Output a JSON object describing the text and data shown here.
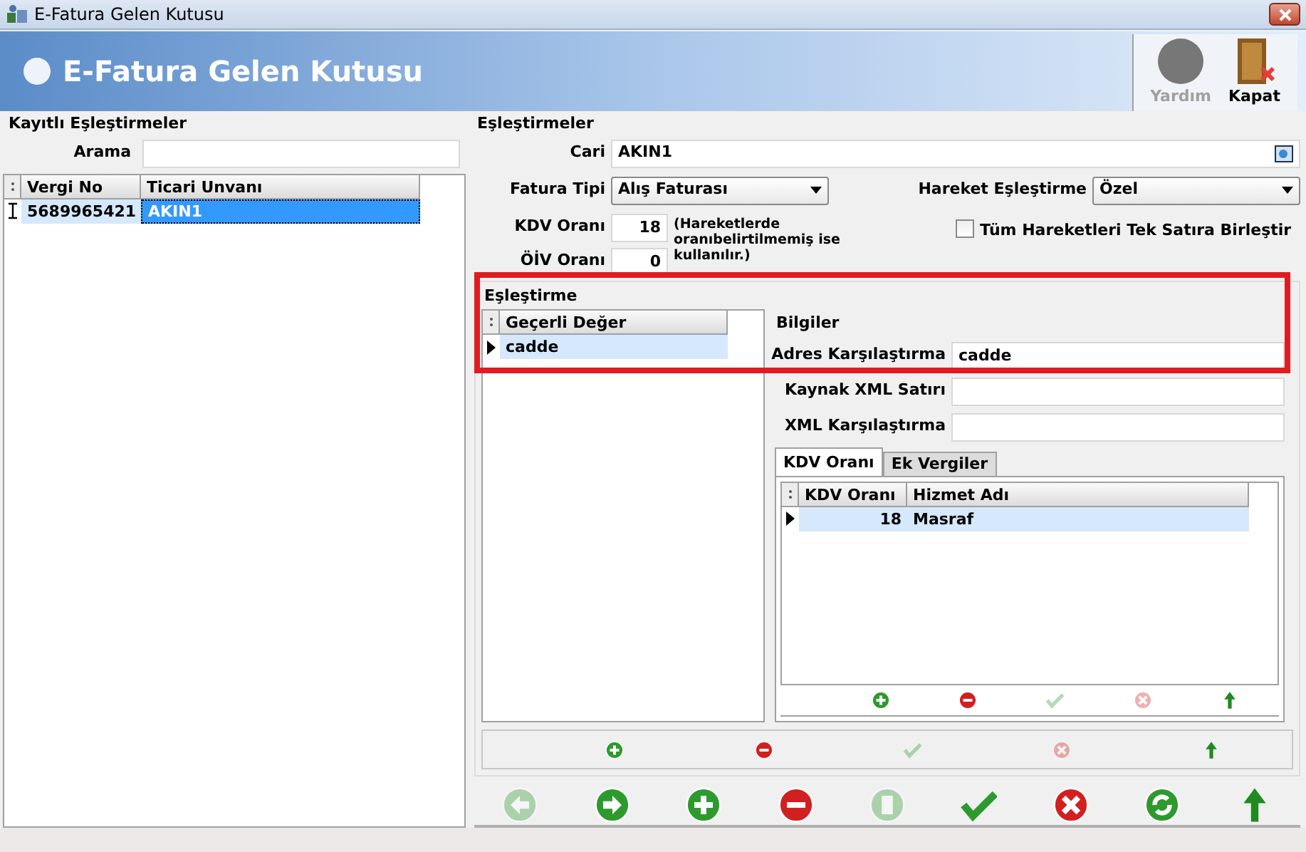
{
  "window": {
    "title": "E-Fatura Gelen Kutusu"
  },
  "header": {
    "title": "E-Fatura Gelen Kutusu",
    "buttons": [
      {
        "kind": "help",
        "label": "Yardım",
        "disabled": true
      },
      {
        "kind": "close",
        "label": "Kapat",
        "disabled": false
      }
    ]
  },
  "saved_mappings": {
    "title": "Kayıtlı Eşleştirmeler",
    "search": {
      "label": "Arama"
    },
    "columns": [
      "Vergi No",
      "Ticari Unvanı"
    ],
    "rows": [
      {
        "cells": [
          "5689965421",
          "AKIN1"
        ],
        "selected": true
      }
    ]
  },
  "mappings": {
    "title": "Eşleştirmeler",
    "cari": {
      "label": "Cari",
      "value": "AKIN1"
    },
    "invoice_type": {
      "label": "Fatura Tipi",
      "value": "Alış Faturası"
    },
    "movement_mapping": {
      "label": "Hareket Eşleştirme",
      "value": "Özel"
    },
    "kdv_rate": {
      "label": "KDV Oranı",
      "value": "18"
    },
    "oiv_rate": {
      "label": "ÖİV Oranı",
      "value": "0"
    },
    "rate_note": "(Hareketlerde oranıbelirtilmemiş ise kullanılır.)",
    "merge_checkbox": {
      "label": "Tüm Hareketleri Tek Satıra Birleştir",
      "checked": false
    }
  },
  "matching": {
    "title": "Eşleştirme",
    "columns": [
      "Geçerli Değer"
    ],
    "rows": [
      {
        "cells": [
          "cadde"
        ],
        "selected": true
      }
    ],
    "info": {
      "title": "Bilgiler",
      "fields": [
        {
          "label": "Adres Karşılaştırma",
          "value": "cadde"
        },
        {
          "label": "Kaynak XML Satırı"
        },
        {
          "label": "XML Karşılaştırma"
        }
      ]
    },
    "tabs": [
      {
        "label": "KDV Oranı",
        "selected": true
      },
      {
        "label": "Ek Vergiler",
        "selected": false
      }
    ],
    "tax_columns": [
      "KDV Oranı",
      "Hizmet Adı"
    ],
    "tax_rows": [
      {
        "cells": [
          "18",
          "Masraf"
        ],
        "selected": true
      }
    ],
    "tax_toolbar": [
      {
        "kind": "add",
        "disabled": false
      },
      {
        "kind": "remove",
        "disabled": false
      },
      {
        "kind": "confirm",
        "disabled": true
      },
      {
        "kind": "cancel",
        "disabled": true
      },
      {
        "kind": "up",
        "disabled": false
      }
    ],
    "toolbar": [
      {
        "kind": "add",
        "disabled": false
      },
      {
        "kind": "remove",
        "disabled": false
      },
      {
        "kind": "confirm",
        "disabled": true
      },
      {
        "kind": "cancel",
        "disabled": true
      },
      {
        "kind": "up",
        "disabled": false
      }
    ]
  },
  "bottom_toolbar": [
    {
      "kind": "back",
      "disabled": true
    },
    {
      "kind": "forward",
      "disabled": false
    },
    {
      "kind": "add",
      "disabled": false
    },
    {
      "kind": "remove",
      "disabled": false
    },
    {
      "kind": "edit",
      "disabled": true
    },
    {
      "kind": "confirm",
      "disabled": false
    },
    {
      "kind": "cancel",
      "disabled": false
    },
    {
      "kind": "refresh",
      "disabled": false
    },
    {
      "kind": "up",
      "disabled": false
    }
  ]
}
